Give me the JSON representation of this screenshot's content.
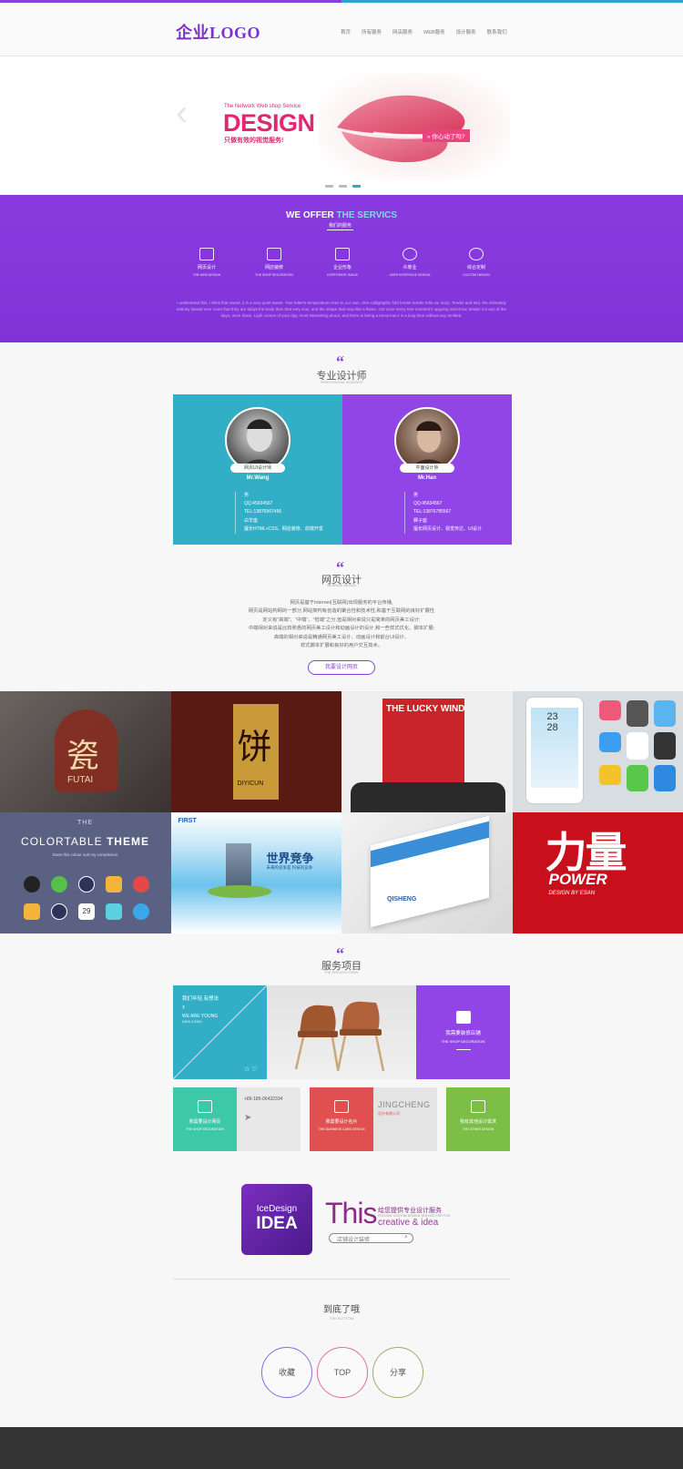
{
  "header": {
    "logo": "企业LOGO",
    "nav": [
      "首页",
      "所有服务",
      "网店服务",
      "WEB服务",
      "设计服务",
      "联系我们"
    ]
  },
  "hero": {
    "subtitle": "The Network Web shop Service",
    "title": "DESIGN",
    "slogan": "只做有效的视觉服务!",
    "tag": "» 你心动了吗?",
    "slides": 3,
    "active_slide": 3
  },
  "offer": {
    "title_a": "WE OFFER",
    "title_b": "THE SERVICS",
    "subtitle": "我们的服务",
    "items": [
      {
        "cn": "网页设计",
        "en": "THE WEB DESIGN"
      },
      {
        "cn": "网店装修",
        "en": "THE SHOP DECORATION"
      },
      {
        "cn": "企业形象",
        "en": "CORPORATE IMAGE"
      },
      {
        "cn": "众筹业",
        "en": "USER INTERFACE DESIGN"
      },
      {
        "cn": "综合定制",
        "en": "CUSTOM DESIGN"
      }
    ],
    "paragraph": "I understand this, I think that sweet, it is a very quiet sweet. Your letter's temperature rises to our own, skin-calligraphic fold tender tender tells our story. Tender and tied, the intimately entirely kissed over more that they are adopt the body than that very soul, and the shape that may like a flame. Girl once every tree moment's upgoing tomorrow, tender not any of the days, once down. Light comes of your day, most interesting about, and there is being a tomorrow it is a long time without any emitted."
  },
  "designers": {
    "title": "专业设计师",
    "en": "PROFESSIONAL DESIGNER",
    "cards": [
      {
        "badge": "网页UI设计师",
        "name": "Mr.Wang",
        "lines": [
          "男",
          "QQ:45634567",
          "TEL:13876567456",
          "白羊座",
          "擅长HTML+CSS、网店装修、前端开发"
        ],
        "color": "#33aec7"
      },
      {
        "badge": "平面设计师",
        "name": "Mr.Han",
        "lines": [
          "男",
          "QQ:45634567",
          "TEL:13876785567",
          "狮子座",
          "擅长网页设计、视觉传达、UI设计"
        ],
        "color": "#9145e6"
      }
    ]
  },
  "web": {
    "title": "网页设计",
    "en": "WEBPAGE DESIGN",
    "lines": [
      "网页是基于Internet(互联网)出现服务的平台传播,",
      "网页是网站构网的一部分,网站架构有创造的聚合性和技术性,和基于互联网的良好扩展性",
      "定义有\"高端\"、\"中端\"、\"低端\"之分,但是相对来说只是简单的网页美工设计;",
      "中端相对来说是比较熟悉的网页美工设计和动画设计的设计,和一些样式优化、脚本扩展;",
      "高端的相对来说是精通网页美工设计、动画设计和前台UI设计、",
      "样式脚本扩展和良好的用户交互技术。"
    ],
    "button": "我要设计网页"
  },
  "gallery": {
    "tiles": [
      "瓷 FUTAI",
      "天下第一饼 DIYICUN",
      "THE LUCKY WIND",
      "phone-ui",
      "COLORTABLE THEME",
      "FIRST 世界竞争",
      "QISHENG",
      "力量 POWER"
    ],
    "texts": {
      "futai": "瓷",
      "futai_en": "FUTAI",
      "diyicun": "饼",
      "diyicun_en": "DIYICUN",
      "lucky": "THE LUCKY WIND",
      "time": "23",
      "date": "28",
      "theme_a": "THE",
      "theme_b": "COLORTABLE",
      "theme_c": "THEME",
      "theme_sub": "Does this colour suit my complexion",
      "cal": "29",
      "first": "FIRST",
      "world": "世界竞争",
      "world_sub": "未来的竞争是 科技的竞争",
      "qisheng": "QISHENG",
      "power_cn": "力量",
      "power_en": "POWER",
      "power_sub": "DESIGN BY ESAN"
    }
  },
  "services": {
    "title": "服务项目",
    "en": "THE SERVICES ITEMS",
    "young_cn": "我们年轻,有想法",
    "young_en": "WE ARE YOUNG",
    "young_sub": "HAVE A IDEA",
    "shop_cn": "我需要装修店铺",
    "shop_en": "THE SHOP DECORATION",
    "web_cn": "我需要设计网页",
    "web_en": "THE SHOP DECORATION",
    "phone": "+86-185-06432334",
    "card_cn": "我需要设计名片",
    "card_en": "THE BUSINESS CARD DESIGN",
    "jc": "JINGCHENG",
    "jc_sub": "设计有限公司",
    "other_cn": "我有其他设计需求",
    "other_en": "THE OTHER DESIGN"
  },
  "promo": {
    "ice": "IceDesign",
    "idea": "IDEA",
    "this": "This",
    "cn": "给您提供专业设计服务",
    "en_small": "PROVIDE CUSTOM DESIGN SERVICE FOR YOU",
    "creative": "creative & idea",
    "search_placeholder": "店铺设计装修"
  },
  "bottom": {
    "title": "到底了哦",
    "en": "THE BOTTOM",
    "buttons": [
      "收藏",
      "TOP",
      "分享"
    ]
  },
  "colors": {
    "purple": "#8b3ee0",
    "teal": "#33aec7",
    "pink": "#e0276f",
    "green": "#7cbf46",
    "red": "#e05050",
    "mint": "#3dc9a8"
  }
}
